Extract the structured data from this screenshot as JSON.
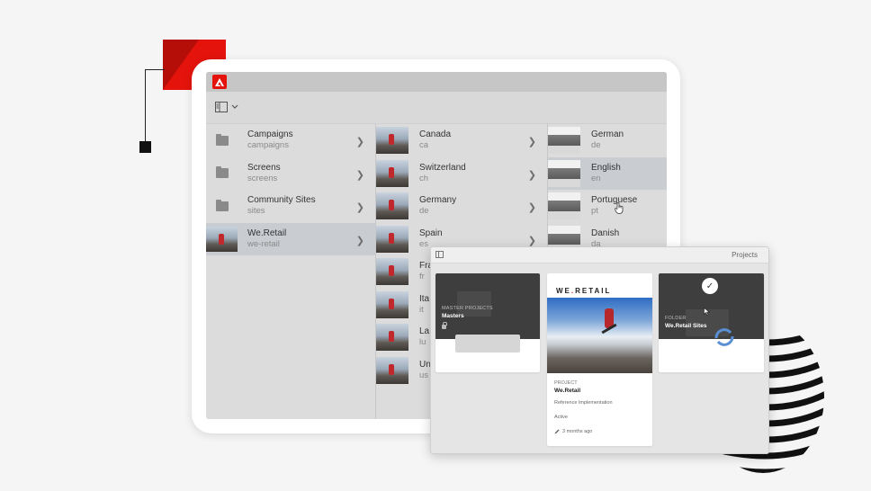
{
  "colors": {
    "brand_red": "#e4140c",
    "selection": "#c9cdd2"
  },
  "icons": {
    "app_logo": "adobe-logo-icon",
    "rail": "rail-toggle-icon",
    "folder": "folder-icon",
    "chevron": "chevron-right-icon"
  },
  "columns": {
    "sites": [
      {
        "title": "Campaigns",
        "name": "campaigns",
        "type": "folder"
      },
      {
        "title": "Screens",
        "name": "screens",
        "type": "folder"
      },
      {
        "title": "Community Sites",
        "name": "sites",
        "type": "folder"
      },
      {
        "title": "We.Retail",
        "name": "we-retail",
        "type": "page",
        "selected": true
      }
    ],
    "countries": [
      {
        "title": "Canada",
        "name": "ca"
      },
      {
        "title": "Switzerland",
        "name": "ch"
      },
      {
        "title": "Germany",
        "name": "de"
      },
      {
        "title": "Spain",
        "name": "es"
      },
      {
        "title": "Fra",
        "name": "fr"
      },
      {
        "title": "Ita",
        "name": "it"
      },
      {
        "title": "La",
        "name": "lu"
      },
      {
        "title": "Un",
        "name": "us"
      }
    ],
    "languages": [
      {
        "title": "German",
        "name": "de"
      },
      {
        "title": "English",
        "name": "en",
        "selected": true
      },
      {
        "title": "Portuguese",
        "name": "pt",
        "hover": true
      },
      {
        "title": "Danish",
        "name": "da"
      }
    ]
  },
  "projects": {
    "title": "Projects",
    "cards": [
      {
        "category": "MASTER PROJECTS",
        "name": "Masters"
      },
      {
        "brand_left": "WE",
        "brand_dot": ".",
        "brand_right": "RETAIL",
        "category": "PROJECT",
        "name": "We.Retail",
        "description": "Reference Implementation",
        "status": "Active",
        "modified": "3 months ago"
      },
      {
        "category": "FOLDER",
        "name": "We.Retail Sites"
      }
    ]
  }
}
